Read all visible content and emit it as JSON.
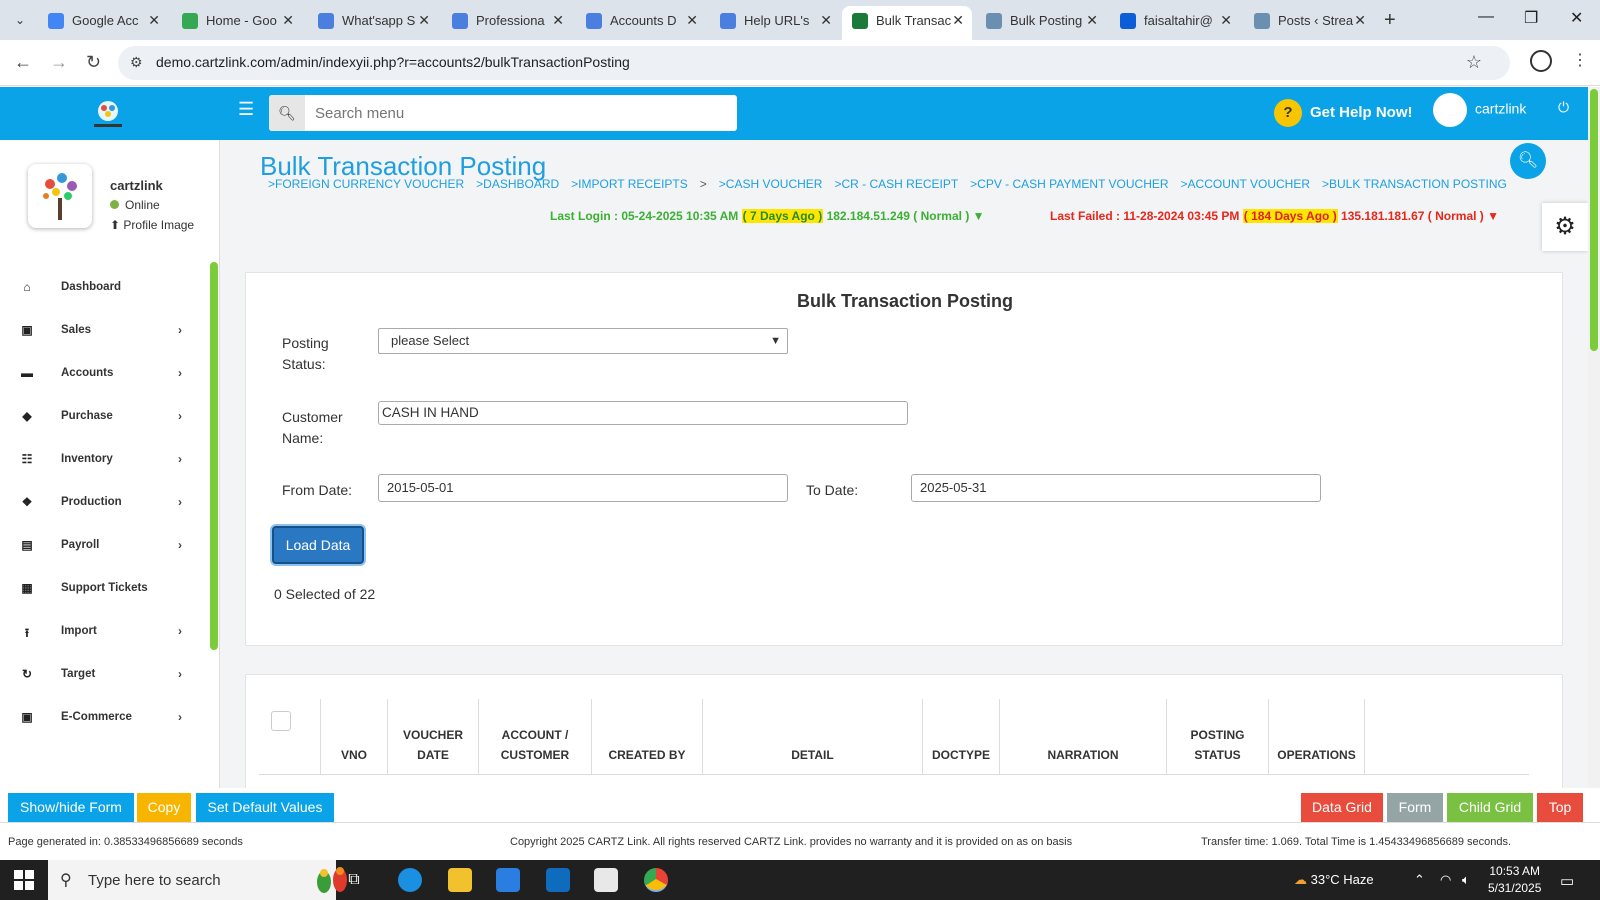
{
  "browser": {
    "tabs": [
      {
        "title": "Google Acc",
        "color": "#4285f4"
      },
      {
        "title": "Home - Goo",
        "color": "#34a853"
      },
      {
        "title": "What'sapp S",
        "color": "#4a7fe0"
      },
      {
        "title": "Professiona",
        "color": "#4a7fe0"
      },
      {
        "title": "Accounts D",
        "color": "#4a7fe0"
      },
      {
        "title": "Help URL's",
        "color": "#4a7fe0"
      },
      {
        "title": "Bulk Transac",
        "color": "#1b7a3a"
      },
      {
        "title": "Bulk Posting",
        "color": "#6a8fb0"
      },
      {
        "title": "faisaltahir@",
        "color": "#0b5ed7"
      },
      {
        "title": "Posts ‹ Strea",
        "color": "#6a8fb0"
      }
    ],
    "url": "demo.cartzlink.com/admin/indexyii.php?r=accounts2/bulkTransactionPosting"
  },
  "header": {
    "search_placeholder": "Search menu",
    "help_label": "Get Help Now!",
    "username": "cartzlink"
  },
  "sidebar": {
    "user": {
      "name": "cartzlink",
      "status": "Online",
      "profile_label": "Profile Image"
    },
    "items": [
      {
        "label": "Dashboard",
        "icon": "home-icon",
        "glyph": "⌂",
        "chevron": false
      },
      {
        "label": "Sales",
        "icon": "cart-icon",
        "glyph": "▣",
        "chevron": true
      },
      {
        "label": "Accounts",
        "icon": "briefcase-icon",
        "glyph": "▬",
        "chevron": true
      },
      {
        "label": "Purchase",
        "icon": "tags-icon",
        "glyph": "◆",
        "chevron": true
      },
      {
        "label": "Inventory",
        "icon": "grid-icon",
        "glyph": "☷",
        "chevron": true
      },
      {
        "label": "Production",
        "icon": "cubes-icon",
        "glyph": "❖",
        "chevron": true
      },
      {
        "label": "Payroll",
        "icon": "money-icon",
        "glyph": "▤",
        "chevron": true
      },
      {
        "label": "Support Tickets",
        "icon": "ticket-icon",
        "glyph": "▦",
        "chevron": false
      },
      {
        "label": "Import",
        "icon": "upload-icon",
        "glyph": "⭱",
        "chevron": true
      },
      {
        "label": "Target",
        "icon": "refresh-icon",
        "glyph": "↻",
        "chevron": true
      },
      {
        "label": "E-Commerce",
        "icon": "cart-icon",
        "glyph": "▣",
        "chevron": true
      }
    ]
  },
  "page": {
    "title": "Bulk Transaction Posting",
    "breadcrumbs": [
      ">FOREIGN CURRENCY VOUCHER",
      ">DASHBOARD",
      ">IMPORT RECEIPTS",
      ">",
      ">CASH VOUCHER",
      ">CR - CASH RECEIPT",
      ">CPV - CASH PAYMENT VOUCHER",
      ">ACCOUNT VOUCHER",
      ">BULK TRANSACTION POSTING"
    ],
    "last_login": {
      "prefix": "Last Login : 05-24-2025 10:35 AM",
      "ago": "( 7 Days Ago )",
      "suffix": "182.184.51.249 ( Normal ) ▼"
    },
    "last_failed": {
      "prefix": "Last Failed : 11-28-2024 03:45 PM",
      "ago": "( 184 Days Ago )",
      "suffix": "135.181.181.67 ( Normal ) ▼"
    }
  },
  "form": {
    "heading": "Bulk Transaction Posting",
    "posting_status_label_1": "Posting",
    "posting_status_label_2": "Status:",
    "posting_status_value": "please Select",
    "customer_label_1": "Customer",
    "customer_label_2": "Name:",
    "customer_value": "CASH IN HAND",
    "from_label": "From Date:",
    "from_value": "2015-05-01",
    "to_label": "To Date:",
    "to_value": "2025-05-31",
    "load_button": "Load Data",
    "selected_text": "0 Selected of 22"
  },
  "grid": {
    "columns": [
      "",
      "VNO",
      "VOUCHER DATE",
      "ACCOUNT / CUSTOMER",
      "CREATED BY",
      "DETAIL",
      "DOCTYPE",
      "NARRATION",
      "POSTING STATUS",
      "OPERATIONS"
    ]
  },
  "bottom_buttons": {
    "left": [
      {
        "label": "Show/hide Form",
        "color": "#0aa3e8"
      },
      {
        "label": "Copy",
        "color": "#f7b500"
      },
      {
        "label": "Set Default Values",
        "color": "#0aa3e8"
      }
    ],
    "right": [
      {
        "label": "Data Grid",
        "color": "#e74c3c"
      },
      {
        "label": "Form",
        "color": "#95a5a6"
      },
      {
        "label": "Child Grid",
        "color": "#7ac143"
      },
      {
        "label": "Top",
        "color": "#e74c3c"
      }
    ]
  },
  "footer": {
    "left": "Page generated in: 0.38533496856689 seconds",
    "center": "Copyright 2025 CARTZ Link. All rights reserved CARTZ Link. provides no warranty and it is provided on as on basis",
    "right": "Transfer time: 1.069. Total Time is 1.45433496856689 seconds."
  },
  "taskbar": {
    "search_text": "Type here to search",
    "weather": "33°C  Haze",
    "time": "10:53 AM",
    "date": "5/31/2025"
  }
}
